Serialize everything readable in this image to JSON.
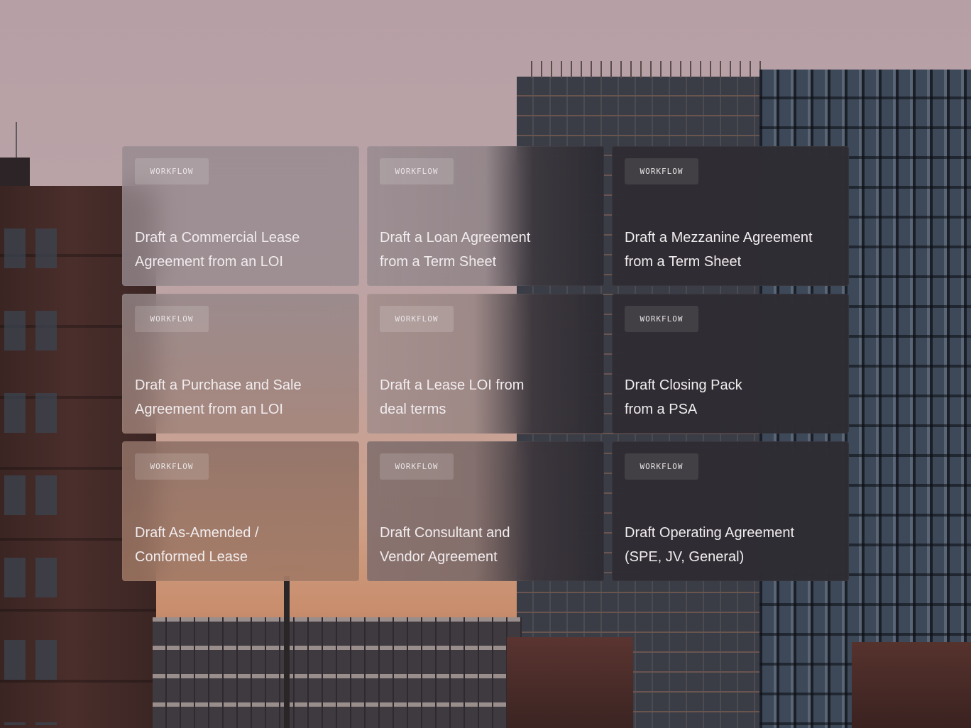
{
  "workflows": [
    {
      "tag": "WORKFLOW",
      "title": "Draft a Commercial Lease\nAgreement from an LOI"
    },
    {
      "tag": "WORKFLOW",
      "title": "Draft a Loan Agreement\nfrom a Term Sheet"
    },
    {
      "tag": "WORKFLOW",
      "title": "Draft a Mezzanine Agreement\nfrom a Term Sheet"
    },
    {
      "tag": "WORKFLOW",
      "title": "Draft a Purchase and Sale\nAgreement from an LOI"
    },
    {
      "tag": "WORKFLOW",
      "title": "Draft a Lease LOI from\ndeal terms"
    },
    {
      "tag": "WORKFLOW",
      "title": "Draft Closing Pack\nfrom a PSA"
    },
    {
      "tag": "WORKFLOW",
      "title": "Draft As-Amended /\nConformed Lease"
    },
    {
      "tag": "WORKFLOW",
      "title": "Draft Consultant and\nVendor Agreement"
    },
    {
      "tag": "WORKFLOW",
      "title": "Draft Operating Agreement\n(SPE, JV, General)"
    }
  ]
}
